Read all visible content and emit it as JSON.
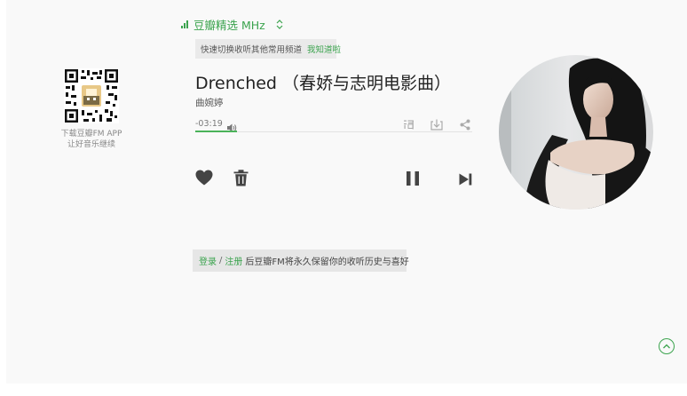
{
  "channel": {
    "name": "豆瓣精选 MHz",
    "signal_icon": "signal-bars-icon",
    "switch_icon": "up-down-chevron-icon"
  },
  "tip": {
    "text": "快速切换收听其他常用频道",
    "ack_label": "我知道啦"
  },
  "app_promo": {
    "line1": "下载豆瓣FM APP",
    "line2": "让好音乐继续",
    "qr_icon": "qr-code"
  },
  "song": {
    "title": "Drenched （春娇与志明电影曲）",
    "artist": "曲婉婷",
    "time_remaining": "-03:19",
    "progress": 0.15
  },
  "tools": {
    "lyrics_icon": "lyrics-icon",
    "download_icon": "download-icon",
    "share_icon": "share-icon",
    "volume_icon": "volume-icon"
  },
  "controls": {
    "like_icon": "heart-icon",
    "trash_icon": "trash-icon",
    "pause_icon": "pause-icon",
    "next_icon": "next-icon"
  },
  "login": {
    "login_label": "登录",
    "separator": "/",
    "register_label": "注册",
    "message": "后豆瓣FM将永久保留你的收听历史与喜好"
  },
  "colors": {
    "accent": "#3aa34d",
    "background": "#f9f9f9",
    "control": "#444444"
  }
}
